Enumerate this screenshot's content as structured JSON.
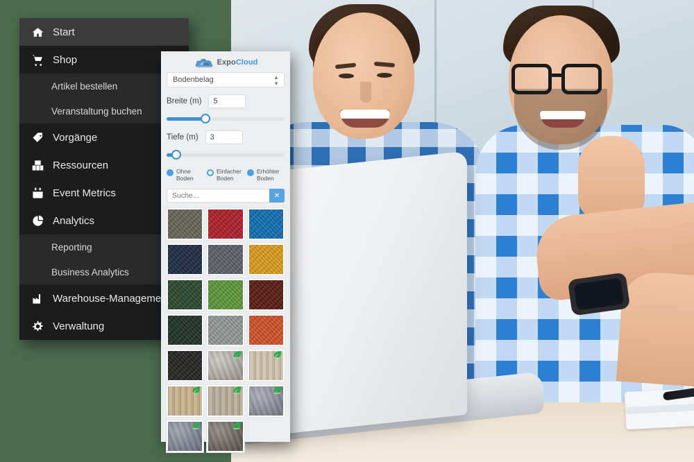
{
  "app": {
    "background_color": "#4a6b4d"
  },
  "sidebar": {
    "items": [
      {
        "label": "Start",
        "icon": "home-icon",
        "type": "main",
        "active": true
      },
      {
        "label": "Shop",
        "icon": "cart-icon",
        "type": "main",
        "active": false
      },
      {
        "label": "Artikel bestellen",
        "icon": "",
        "type": "sub"
      },
      {
        "label": "Veranstaltung buchen",
        "icon": "",
        "type": "sub"
      },
      {
        "label": "Vorgänge",
        "icon": "tag-icon",
        "type": "main",
        "active": false
      },
      {
        "label": "Ressourcen",
        "icon": "boxes-icon",
        "type": "main",
        "active": false
      },
      {
        "label": "Event Metrics",
        "icon": "calendar-icon",
        "type": "main",
        "active": false
      },
      {
        "label": "Analytics",
        "icon": "pie-chart-icon",
        "type": "main",
        "active": false
      },
      {
        "label": "Reporting",
        "icon": "",
        "type": "sub"
      },
      {
        "label": "Business Analytics",
        "icon": "",
        "type": "sub"
      },
      {
        "label": "Warehouse-Management",
        "icon": "factory-icon",
        "type": "main",
        "active": false
      },
      {
        "label": "Verwaltung",
        "icon": "gear-icon",
        "type": "main",
        "active": false
      }
    ]
  },
  "panel": {
    "logo": {
      "name_part1": "Expo",
      "name_part2": "Cloud",
      "icon": "cloud-icon",
      "color_part1": "#59626b",
      "color_part2": "#3d9ae2"
    },
    "category_select": {
      "value": "Bodenbelag",
      "icon": "chevron-updown-icon"
    },
    "width_field": {
      "label": "Breite (m)",
      "value": "5",
      "slider_percent": 33
    },
    "depth_field": {
      "label": "Tiefe (m)",
      "value": "3",
      "slider_percent": 8
    },
    "floor_options": [
      {
        "label_line1": "Ohne",
        "label_line2": "Boden",
        "selected": true
      },
      {
        "label_line1": "Einfacher",
        "label_line2": "Boden",
        "selected": false
      },
      {
        "label_line1": "Erhöhter",
        "label_line2": "Boden",
        "selected": true
      }
    ],
    "search": {
      "placeholder": "Suche...",
      "value": "",
      "clear_label": "✕",
      "clear_color": "#5ba3dd"
    },
    "swatches": [
      {
        "name": "carpet-dark-taupe",
        "color": "#6a665c",
        "eco": false,
        "texture": "weave"
      },
      {
        "name": "carpet-crimson",
        "color": "#b4202c",
        "eco": false,
        "texture": "weave"
      },
      {
        "name": "carpet-azure",
        "color": "#1170b8",
        "eco": false,
        "texture": "weave"
      },
      {
        "name": "carpet-navy",
        "color": "#1f2b47",
        "eco": false,
        "texture": "weave"
      },
      {
        "name": "carpet-slate-grey",
        "color": "#5f636a",
        "eco": false,
        "texture": "weave"
      },
      {
        "name": "carpet-amber",
        "color": "#e0a01f",
        "eco": false,
        "texture": "weave"
      },
      {
        "name": "carpet-forest",
        "color": "#2a4b2c",
        "eco": false,
        "texture": "weave"
      },
      {
        "name": "carpet-apple-green",
        "color": "#5f9a3a",
        "eco": false,
        "texture": "weave"
      },
      {
        "name": "carpet-maroon",
        "color": "#5c1c13",
        "eco": false,
        "texture": "weave"
      },
      {
        "name": "carpet-deep-green",
        "color": "#1d3326",
        "eco": false,
        "texture": "weave"
      },
      {
        "name": "carpet-light-grey",
        "color": "#97999a",
        "eco": false,
        "texture": "weave"
      },
      {
        "name": "carpet-orange",
        "color": "#d6532a",
        "eco": false,
        "texture": "weave"
      },
      {
        "name": "carpet-charcoal",
        "color": "#262422",
        "eco": false,
        "texture": "weave"
      },
      {
        "name": "stone-pale-grey",
        "color": "#bdb7ad",
        "eco": true,
        "texture": "stone"
      },
      {
        "name": "wood-pale-oak",
        "color": "#cdc0ab",
        "eco": true,
        "texture": "wood"
      },
      {
        "name": "wood-warm-oak",
        "color": "#c7ae8c",
        "eco": true,
        "texture": "wood"
      },
      {
        "name": "wood-grey-oak",
        "color": "#b6ab98",
        "eco": true,
        "texture": "wood"
      },
      {
        "name": "stone-blue-grey",
        "color": "#8e93a0",
        "eco": true,
        "texture": "stone"
      },
      {
        "name": "stone-steel-blue",
        "color": "#7e8697",
        "eco": true,
        "texture": "stone"
      },
      {
        "name": "stone-dark-brown",
        "color": "#6c6259",
        "eco": true,
        "texture": "stone"
      },
      {
        "name": "swatch-empty-slot",
        "color": "",
        "eco": false,
        "texture": "none"
      }
    ],
    "eco_badge": {
      "icon": "leaf-icon",
      "color": "#2faa4b"
    }
  },
  "photo": {
    "alt": "two smiling men in blue checked shirts looking at a laptop at a desk"
  }
}
